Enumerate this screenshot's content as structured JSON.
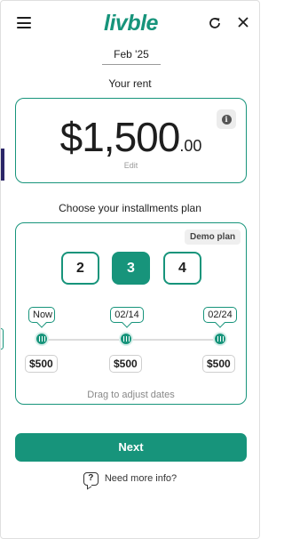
{
  "header": {
    "logo_text": "livble",
    "menu_icon": "hamburger-menu-icon",
    "refresh_icon": "refresh-icon",
    "close_icon": "close-icon"
  },
  "month_tab": "Feb '25",
  "rent": {
    "label": "Your rent",
    "amount_main": "$1,500",
    "amount_cents": ".00",
    "edit_label": "Edit",
    "info_icon": "info-icon"
  },
  "plan": {
    "label": "Choose your installments plan",
    "demo_badge": "Demo plan",
    "options": [
      "2",
      "3",
      "4"
    ],
    "selected_option": "3",
    "installments": [
      {
        "date": "Now",
        "amount": "$500"
      },
      {
        "date": "02/14",
        "amount": "$500"
      },
      {
        "date": "02/24",
        "amount": "$500"
      }
    ],
    "drag_hint": "Drag to adjust dates"
  },
  "next_button": "Next",
  "more_info": {
    "label": "Need more info?",
    "icon": "question-chat-icon"
  },
  "colors": {
    "accent": "#17947b",
    "edge_accent": "#2b2668"
  }
}
